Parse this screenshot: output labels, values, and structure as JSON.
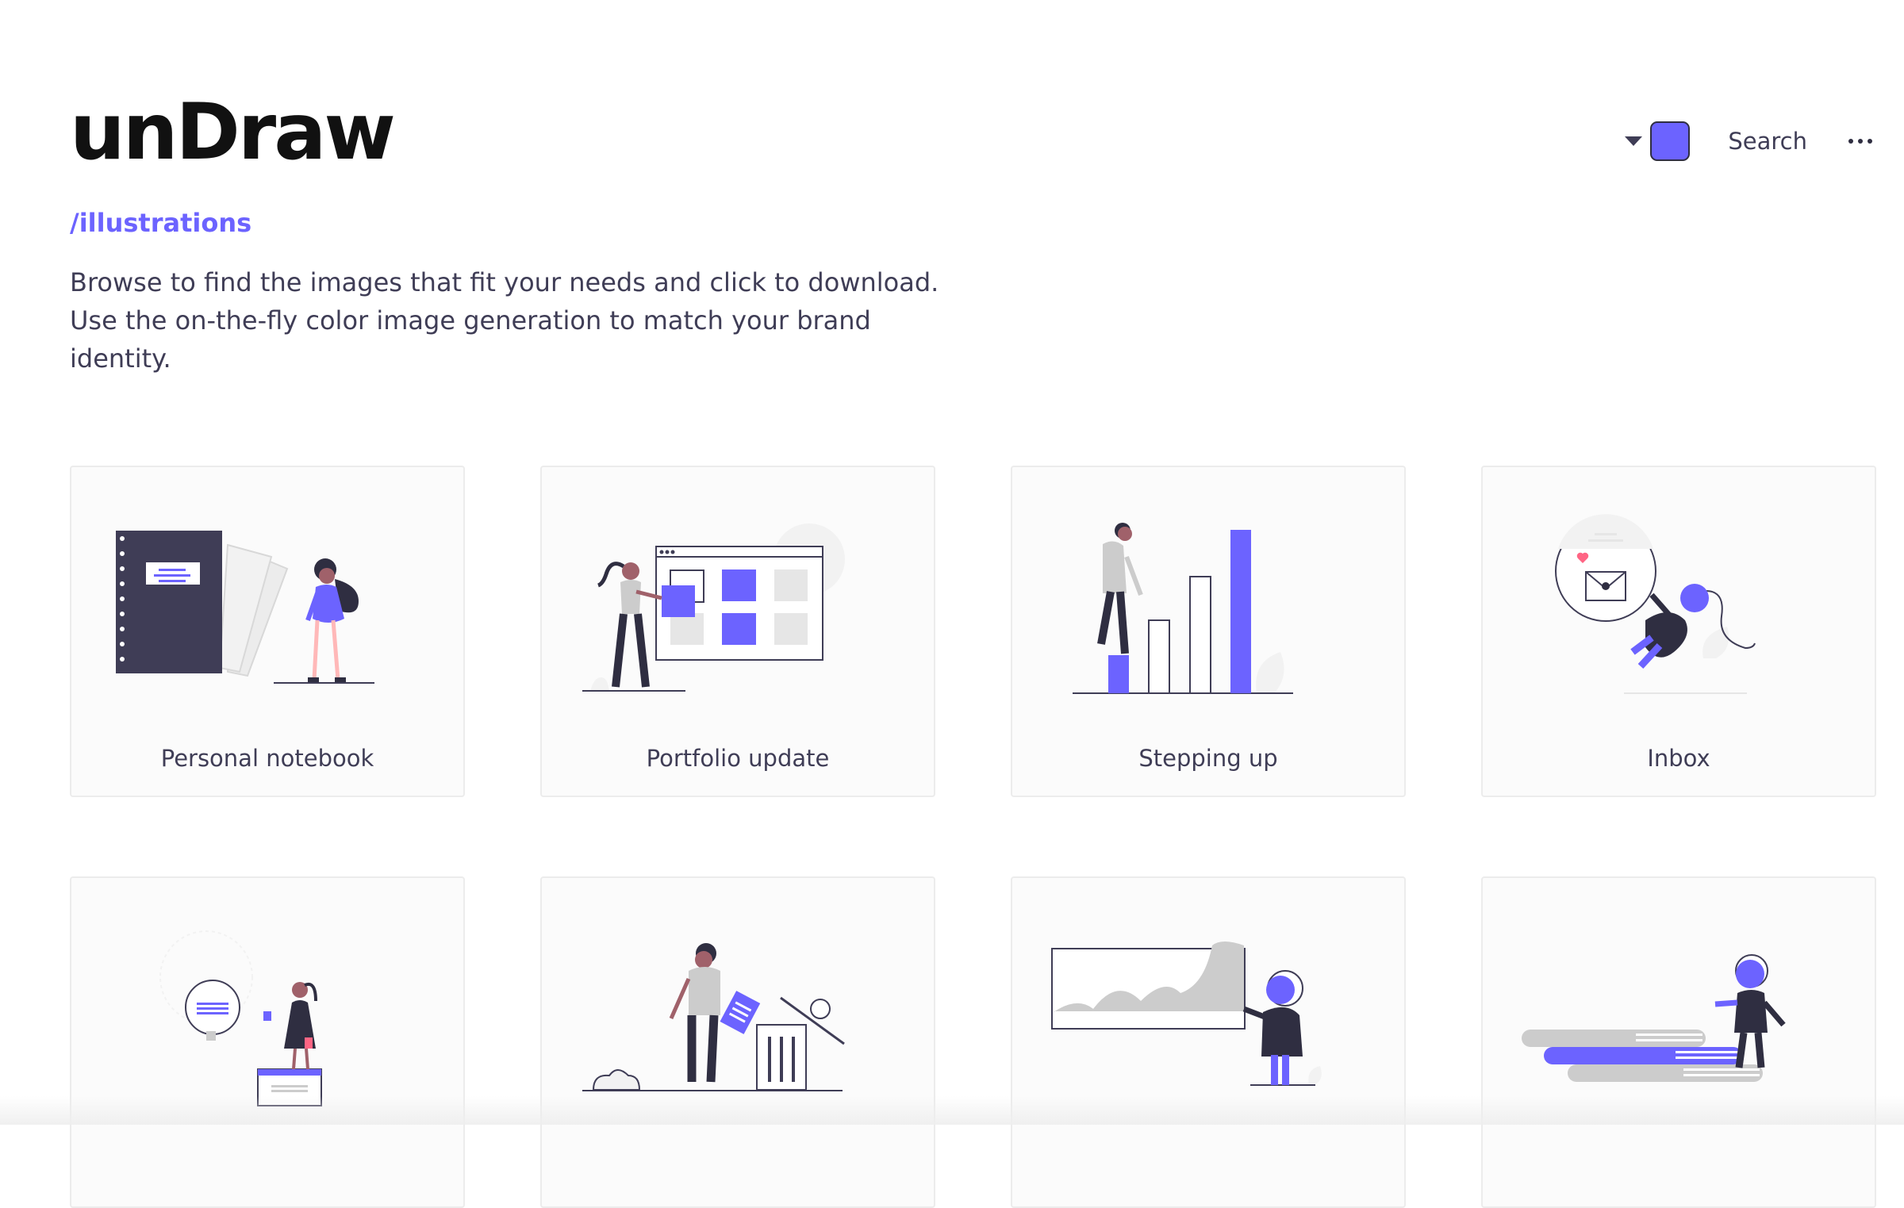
{
  "header": {
    "logo": "unDraw",
    "breadcrumb": "/illustrations",
    "intro": "Browse to find the images that fit your needs and click to download. Use the on-the-fly color image generation to match your brand identity."
  },
  "toolbar": {
    "accent_color": "#6c63ff",
    "search_label": "Search",
    "color_picker_icon": "chevron-down-icon",
    "more_icon": "more-horizontal-icon"
  },
  "illustrations": [
    {
      "title": "Personal notebook"
    },
    {
      "title": "Portfolio update"
    },
    {
      "title": "Stepping up"
    },
    {
      "title": "Inbox"
    },
    {
      "title": ""
    },
    {
      "title": ""
    },
    {
      "title": ""
    },
    {
      "title": ""
    }
  ],
  "colors": {
    "accent": "#6c63ff",
    "dark": "#2f2e41",
    "gray": "#cccccc",
    "card_bg": "#fbfbfb"
  }
}
